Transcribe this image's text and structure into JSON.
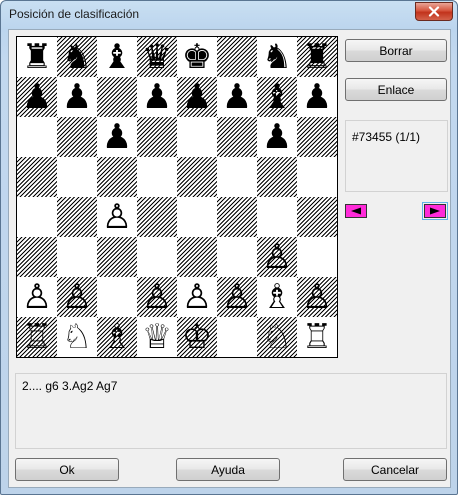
{
  "window": {
    "title": "Posición de clasificación"
  },
  "buttons": {
    "borrar": "Borrar",
    "enlace": "Enlace",
    "ok": "Ok",
    "ayuda": "Ayuda",
    "cancelar": "Cancelar"
  },
  "info": {
    "position_id": "#73455 (1/1)"
  },
  "moves": {
    "text": "2.... g6  3.Ag2 Ag7"
  },
  "colors": {
    "nav_button": "#ff2bd9",
    "close_button": "#c2331c"
  },
  "board": {
    "ranks": [
      [
        "bR",
        "bN",
        "bB",
        "bQ",
        "bK",
        "",
        "bN",
        "bR"
      ],
      [
        "bP",
        "bP",
        "",
        "bP",
        "bP",
        "bP",
        "bB",
        "bP"
      ],
      [
        "",
        "",
        "bP",
        "",
        "",
        "",
        "bP",
        ""
      ],
      [
        "",
        "",
        "",
        "",
        "",
        "",
        "",
        ""
      ],
      [
        "",
        "",
        "wP",
        "",
        "",
        "",
        "",
        ""
      ],
      [
        "",
        "",
        "",
        "",
        "",
        "",
        "wP",
        ""
      ],
      [
        "wP",
        "wP",
        "",
        "wP",
        "wP",
        "wP",
        "wB",
        "wP"
      ],
      [
        "wR",
        "wN",
        "wB",
        "wQ",
        "wK",
        "",
        "wN",
        "wR"
      ]
    ]
  }
}
